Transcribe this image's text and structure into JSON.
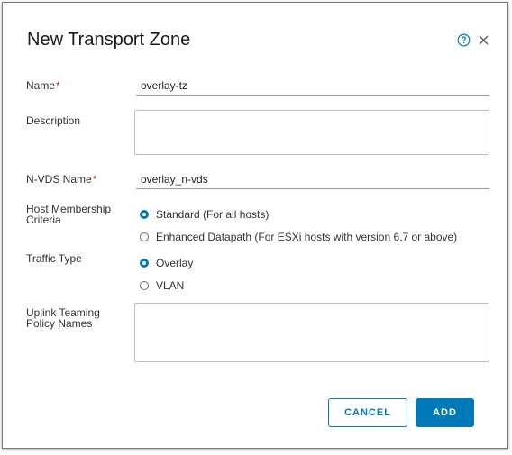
{
  "dialog": {
    "title": "New Transport Zone"
  },
  "form": {
    "name": {
      "label": "Name",
      "required_mark": "*",
      "value": "overlay-tz"
    },
    "description": {
      "label": "Description",
      "value": ""
    },
    "nvds_name": {
      "label": "N-VDS Name",
      "required_mark": "*",
      "value": "overlay_n-vds"
    },
    "host_membership": {
      "label_line1": "Host Membership",
      "label_line2": "Criteria",
      "options": [
        {
          "label": "Standard (For all hosts)",
          "checked": true
        },
        {
          "label": "Enhanced Datapath (For ESXi hosts with version 6.7 or above)",
          "checked": false
        }
      ]
    },
    "traffic_type": {
      "label": "Traffic Type",
      "options": [
        {
          "label": "Overlay",
          "checked": true
        },
        {
          "label": "VLAN",
          "checked": false
        }
      ]
    },
    "uplink_teaming": {
      "label_line1": "Uplink Teaming",
      "label_line2": "Policy Names",
      "value": ""
    }
  },
  "footer": {
    "cancel_label": "CANCEL",
    "add_label": "ADD"
  },
  "icons": {
    "help": "help-circle-icon",
    "close": "close-icon"
  },
  "colors": {
    "accent": "#0079b8",
    "required": "#c92100"
  }
}
